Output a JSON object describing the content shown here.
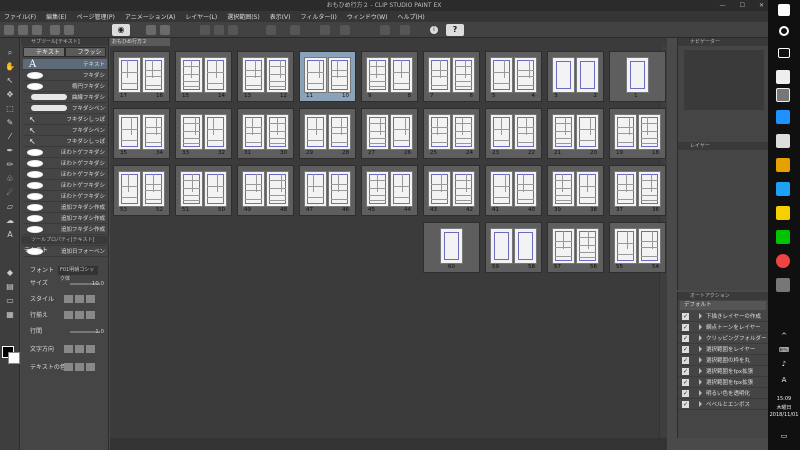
{
  "window": {
    "title": "おもひめ行方２ - CLIP STUDIO PAINT EX",
    "controls": [
      "—",
      "☐",
      "✕"
    ]
  },
  "menu": [
    "ファイル(F)",
    "編集(E)",
    "ページ管理(P)",
    "アニメーション(A)",
    "レイヤー(L)",
    "選択範囲(S)",
    "表示(V)",
    "フィルター(I)",
    "ウィンドウ(W)",
    "ヘルプ(H)"
  ],
  "toolbar": {
    "view_icon": "eye-icon",
    "info_icon": "i",
    "help_label": "?"
  },
  "subtool": {
    "panel_title": "サブツール[テキスト]",
    "tabs": [
      "テキスト",
      "フラッシュ"
    ],
    "items": [
      {
        "label": "テキスト",
        "kind": "text"
      },
      {
        "label": "フキダシ",
        "kind": "oval"
      },
      {
        "label": "楕円フキダシ",
        "kind": "oval"
      },
      {
        "label": "曲線フキダシ",
        "kind": "wave"
      },
      {
        "label": "フキダシペン",
        "kind": "wave"
      },
      {
        "label": "フキダシしっぽ",
        "kind": "tail"
      },
      {
        "label": "フキダシペン",
        "kind": "tail"
      },
      {
        "label": "フキダシしっぽ",
        "kind": "tail"
      },
      {
        "label": "ほわトゲフキダシ",
        "kind": "cloud"
      },
      {
        "label": "ほわトゲフキダシ",
        "kind": "cloud"
      },
      {
        "label": "ほわトゲフキダシ",
        "kind": "cloud"
      },
      {
        "label": "ほわトゲフキダシ",
        "kind": "cloud"
      },
      {
        "label": "ほわトゲフキダシ",
        "kind": "cloud"
      },
      {
        "label": "追加フキダシ作成",
        "kind": "cloud"
      },
      {
        "label": "追加フキダシ作成",
        "kind": "cloud"
      },
      {
        "label": "追加フキダシ作成",
        "kind": "cloud"
      },
      {
        "label": "追加フキダシ作成",
        "kind": "cloud"
      },
      {
        "label": "追加日フォーベン",
        "kind": "cloud"
      }
    ]
  },
  "toolprops": {
    "panel_title": "ツールプロパティ[テキスト]",
    "tool_name": "テキスト",
    "rows": [
      {
        "label": "フォント",
        "value": "F01明朝ゴシック体"
      },
      {
        "label": "サイズ",
        "value": "10.0"
      },
      {
        "label": "スタイル",
        "value": ""
      },
      {
        "label": "行揃え",
        "value": ""
      },
      {
        "label": "行間",
        "value": "1.0"
      },
      {
        "label": "文字方向",
        "value": ""
      },
      {
        "label": "テキストの色",
        "value": ""
      }
    ]
  },
  "pageview": {
    "tab": "おもひめ行方２",
    "spreads": [
      {
        "row": 0,
        "col": 0,
        "left": "17",
        "right": "16"
      },
      {
        "row": 0,
        "col": 1,
        "left": "15",
        "right": "14"
      },
      {
        "row": 0,
        "col": 2,
        "left": "13",
        "right": "12"
      },
      {
        "row": 0,
        "col": 3,
        "left": "11",
        "right": "10",
        "highlight": true
      },
      {
        "row": 0,
        "col": 4,
        "left": "9",
        "right": "8"
      },
      {
        "row": 0,
        "col": 5,
        "left": "7",
        "right": "6"
      },
      {
        "row": 0,
        "col": 6,
        "left": "5",
        "right": "4"
      },
      {
        "row": 0,
        "col": 7,
        "left": "3",
        "right": "2"
      },
      {
        "row": 0,
        "col": 8,
        "single": "1"
      },
      {
        "row": 1,
        "col": 0,
        "left": "35",
        "right": "34"
      },
      {
        "row": 1,
        "col": 1,
        "left": "33",
        "right": "32"
      },
      {
        "row": 1,
        "col": 2,
        "left": "31",
        "right": "30"
      },
      {
        "row": 1,
        "col": 3,
        "left": "29",
        "right": "28"
      },
      {
        "row": 1,
        "col": 4,
        "left": "27",
        "right": "26"
      },
      {
        "row": 1,
        "col": 5,
        "left": "25",
        "right": "24"
      },
      {
        "row": 1,
        "col": 6,
        "left": "23",
        "right": "22"
      },
      {
        "row": 1,
        "col": 7,
        "left": "21",
        "right": "20"
      },
      {
        "row": 1,
        "col": 8,
        "left": "19",
        "right": "18"
      },
      {
        "row": 2,
        "col": 0,
        "left": "53",
        "right": "52"
      },
      {
        "row": 2,
        "col": 1,
        "left": "51",
        "right": "50"
      },
      {
        "row": 2,
        "col": 2,
        "left": "49",
        "right": "48"
      },
      {
        "row": 2,
        "col": 3,
        "left": "47",
        "right": "46"
      },
      {
        "row": 2,
        "col": 4,
        "left": "45",
        "right": "44"
      },
      {
        "row": 2,
        "col": 5,
        "left": "43",
        "right": "42"
      },
      {
        "row": 2,
        "col": 6,
        "left": "41",
        "right": "40"
      },
      {
        "row": 2,
        "col": 7,
        "left": "39",
        "right": "38"
      },
      {
        "row": 2,
        "col": 8,
        "left": "37",
        "right": "36"
      },
      {
        "row": 3,
        "col": 5,
        "single": "60"
      },
      {
        "row": 3,
        "col": 6,
        "left": "59",
        "right": "58"
      },
      {
        "row": 3,
        "col": 7,
        "left": "57",
        "right": "56"
      },
      {
        "row": 3,
        "col": 8,
        "left": "55",
        "right": "54"
      }
    ]
  },
  "navigator": {
    "title": "ナビゲーター"
  },
  "layers": {
    "title": "レイヤー"
  },
  "autoaction": {
    "title": "オートアクション",
    "set_name": "デフォルト",
    "items": [
      "下描きレイヤーの作成",
      "網点トーンをレイヤー",
      "クリッピングフォルダー",
      "選択範囲をレイヤー",
      "選択範囲の枠を丸",
      "選択範囲をfpx拡張",
      "選択範囲をfpx拡張",
      "明るい色を透明化",
      "ベベルとエンボス"
    ]
  },
  "taskbar": {
    "time": "15:09",
    "day": "木曜日",
    "date": "2018/11/01",
    "ime": "A"
  }
}
